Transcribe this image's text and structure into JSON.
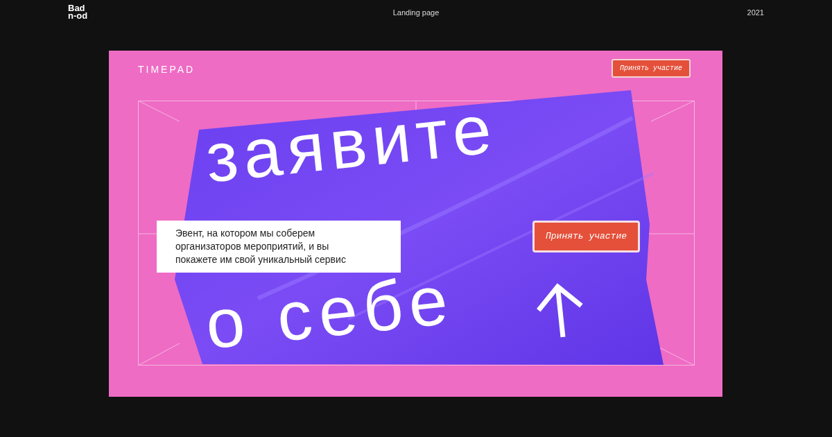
{
  "header": {
    "logo": [
      "Bad",
      "n-od"
    ],
    "title": "Landing page",
    "year": "2021"
  },
  "artboard": {
    "brand": "TIMEPAD",
    "top_button": "Принять участие",
    "headline_top": "заявите",
    "headline_bottom": "о себе",
    "description": "Эвент, на котором мы соберем организаторов мероприятий, и вы покажете им свой уникальный сервис",
    "cta_button": "Принять участие"
  }
}
